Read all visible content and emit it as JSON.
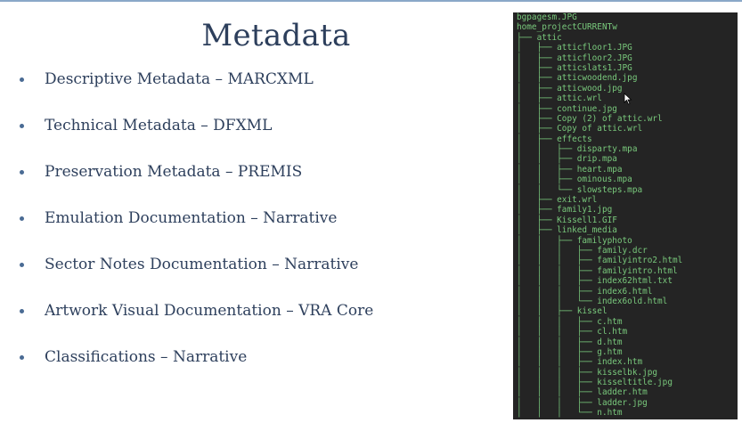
{
  "slide": {
    "title": "Metadata",
    "bullets": [
      "Descriptive Metadata – MARCXML",
      "Technical Metadata – DFXML",
      "Preservation Metadata – PREMIS",
      "Emulation Documentation – Narrative",
      "Sector Notes Documentation – Narrative",
      "Artwork Visual Documentation – VRA Core",
      "Classifications – Narrative"
    ]
  },
  "terminal": {
    "lines": [
      "bgpagesm.JPG",
      "home_projectCURRENTw",
      "├── attic",
      "│   ├── atticfloor1.JPG",
      "│   ├── atticfloor2.JPG",
      "│   ├── atticslats1.JPG",
      "│   ├── atticwoodend.jpg",
      "│   ├── atticwood.jpg",
      "│   ├── attic.wrl",
      "│   ├── continue.jpg",
      "│   ├── Copy (2) of attic.wrl",
      "│   ├── Copy of attic.wrl",
      "│   ├── effects",
      "│   │   ├── disparty.mpa",
      "│   │   ├── drip.mpa",
      "│   │   ├── heart.mpa",
      "│   │   ├── ominous.mpa",
      "│   │   └── slowsteps.mpa",
      "│   ├── exit.wrl",
      "│   ├── family1.jpg",
      "│   ├── Kissell1.GIF",
      "│   ├── linked_media",
      "│   │   ├── familyphoto",
      "│   │   │   ├── family.dcr",
      "│   │   │   ├── familyintro2.html",
      "│   │   │   ├── familyintro.html",
      "│   │   │   ├── index62html.txt",
      "│   │   │   ├── index6.html",
      "│   │   │   └── index6old.html",
      "│   │   ├── kissel",
      "│   │   │   ├── c.htm",
      "│   │   │   ├── cl.htm",
      "│   │   │   ├── d.htm",
      "│   │   │   ├── g.htm",
      "│   │   │   ├── index.htm",
      "│   │   │   ├── kisselbk.jpg",
      "│   │   │   ├── kisseltitle.jpg",
      "│   │   │   ├── ladder.htm",
      "│   │   │   ├── ladder.jpg",
      "│   │   │   └── n.htm"
    ]
  },
  "colors": {
    "text": "#2d3f5c",
    "bullet": "#4a6b94",
    "terminal_bg": "#242424",
    "terminal_text": "#79c97c"
  }
}
